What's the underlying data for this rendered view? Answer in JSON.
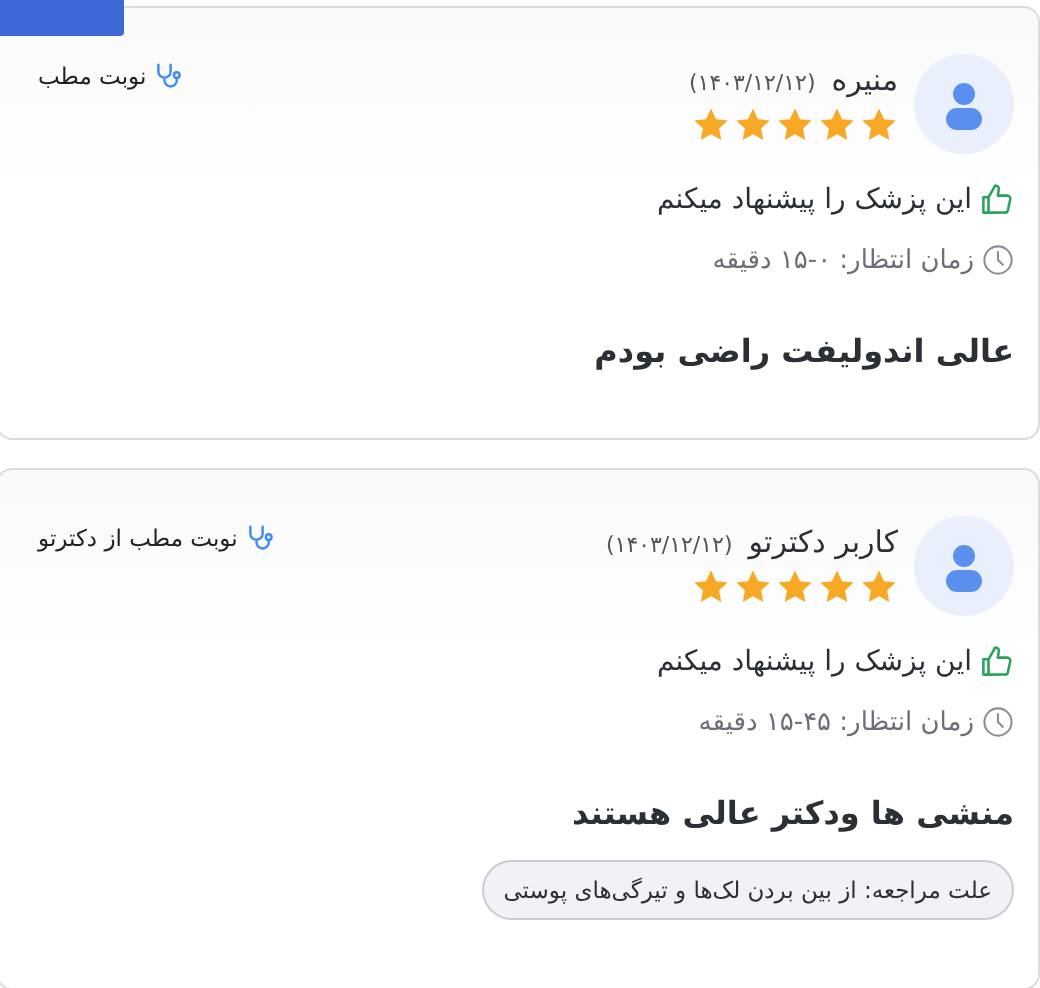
{
  "reviews": [
    {
      "name": "منیره",
      "date": "(۱۴۰۳/۱۲/۱۲)",
      "stars": 5,
      "appointment": "نوبت مطب",
      "recommend": "این پزشک را پیشنهاد میکنم",
      "wait": "زمان انتظار: ۰-۱۵ دقیقه",
      "comment": "عالی اندولیفت راضی بودم"
    },
    {
      "name": "کاربر دکترتو",
      "date": "(۱۴۰۳/۱۲/۱۲)",
      "stars": 5,
      "appointment": "نوبت مطب از دکترتو",
      "recommend": "این پزشک را پیشنهاد میکنم",
      "wait": "زمان انتظار: ۴۵-۱۵ دقیقه",
      "comment": "منشی ها ودکتر عالی هستند",
      "reason": "علت مراجعه: از بین بردن لک‌ها و تیرگی‌های پوستی"
    }
  ]
}
